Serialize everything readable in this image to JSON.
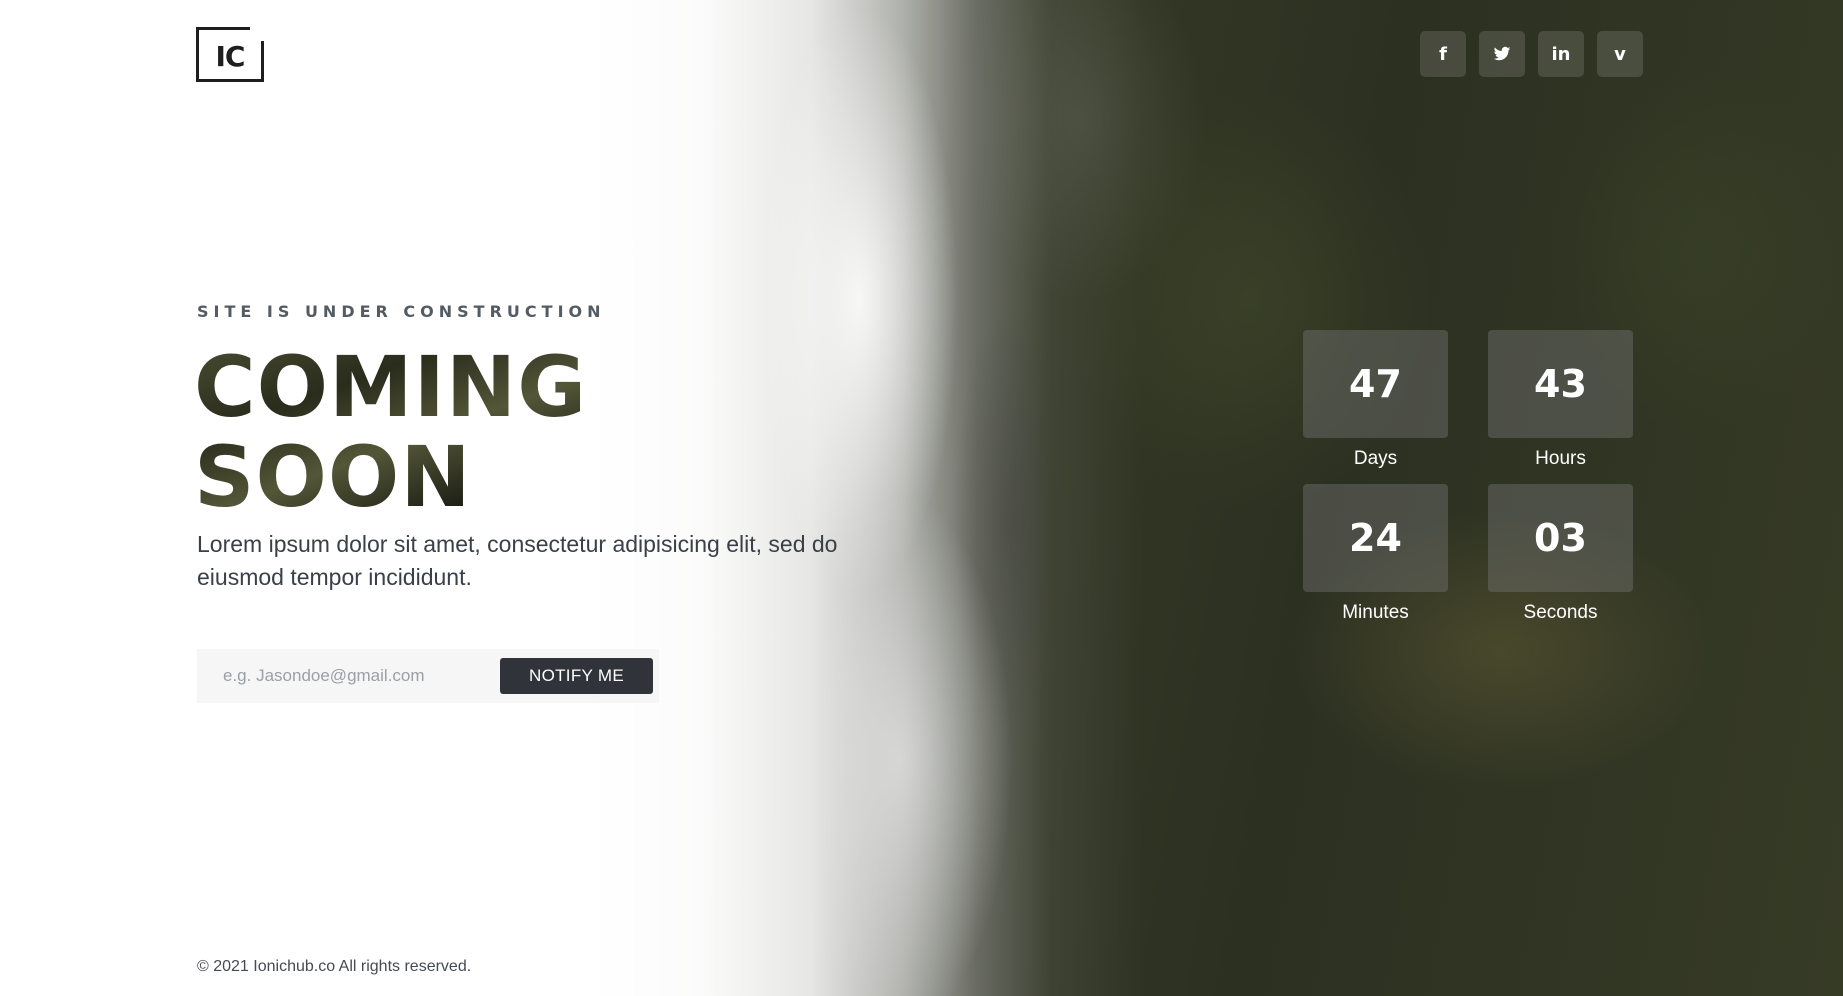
{
  "brand": {
    "logo_text": "IC"
  },
  "social": [
    {
      "name": "facebook",
      "glyph": "f"
    },
    {
      "name": "twitter",
      "glyph": "twitter-icon"
    },
    {
      "name": "linkedin",
      "glyph": "in"
    },
    {
      "name": "vimeo",
      "glyph": "v"
    }
  ],
  "hero": {
    "eyebrow": "SITE IS UNDER CONSTRUCTION",
    "headline_line1": "COMING",
    "headline_line2": "SOON",
    "lead": "Lorem ipsum dolor sit amet, consectetur adipisicing elit, sed do eiusmod tempor incididunt."
  },
  "form": {
    "email_placeholder": "e.g. Jasondoe@gmail.com",
    "notify_label": "NOTIFY ME"
  },
  "countdown": [
    {
      "value": "47",
      "label": "Days"
    },
    {
      "value": "43",
      "label": "Hours"
    },
    {
      "value": "24",
      "label": "Minutes"
    },
    {
      "value": "03",
      "label": "Seconds"
    }
  ],
  "footer": {
    "copyright": "© 2021 Ionichub.co All rights reserved."
  },
  "colors": {
    "button_bg": "#30333a",
    "text_dark": "#2b2f33",
    "eyebrow": "#545b63"
  }
}
